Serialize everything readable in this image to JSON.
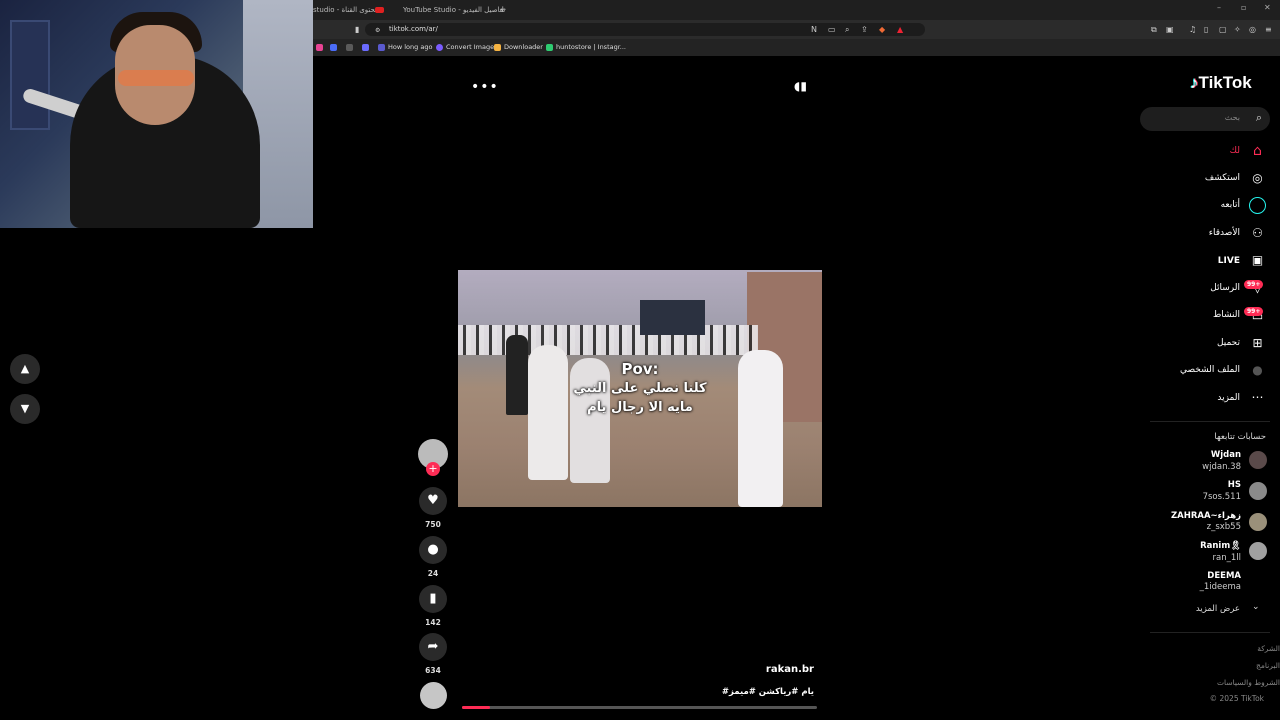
{
  "browser": {
    "tabs": [
      {
        "label": "studio - محتوى القناة"
      },
      {
        "label": ""
      },
      {
        "label": "YouTube Studio - تفاصيل الفيديو"
      }
    ],
    "new_tab": "+",
    "url": "tiktok.com/ar/",
    "bookmarks": [
      {
        "label": "",
        "color": "#e84393"
      },
      {
        "label": "",
        "color": "#4a6cf7"
      },
      {
        "label": "",
        "color": "#5a5a5a"
      },
      {
        "label": "",
        "color": "#6b6bff"
      },
      {
        "label": "How long ago",
        "color": "#5a5acf"
      },
      {
        "label": "Convert Image",
        "color": "#7b5cff"
      },
      {
        "label": "Downloader",
        "color": "#f5b342"
      },
      {
        "label": "huntostore | Instagr...",
        "color": "#2ecc71"
      }
    ]
  },
  "tiktok": {
    "logo": "TikTok",
    "search_placeholder": "بحث",
    "nav": [
      {
        "label": "لك",
        "icon": "home-icon",
        "active": true
      },
      {
        "label": "استكشف",
        "icon": "compass-icon"
      },
      {
        "label": "أتابعه",
        "icon": "following-icon"
      },
      {
        "label": "الأصدقاء",
        "icon": "friends-icon"
      },
      {
        "label": "LIVE",
        "icon": "live-icon"
      },
      {
        "label": "الرسائل",
        "icon": "messages-icon",
        "badge": "99+"
      },
      {
        "label": "النشاط",
        "icon": "activity-icon",
        "badge": "99+"
      },
      {
        "label": "تحميل",
        "icon": "upload-icon"
      },
      {
        "label": "الملف الشخصي",
        "icon": "profile-icon"
      },
      {
        "label": "المزيد",
        "icon": "more-icon"
      }
    ],
    "following_title": "حسابات تتابعها",
    "accounts": [
      {
        "name": "Wjdan",
        "user": "wjdan.38"
      },
      {
        "name": "HS",
        "user": "7sos.511"
      },
      {
        "name": "ZAHRAA~زهراء",
        "user": "z_sxb55"
      },
      {
        "name": "Ranim🎗",
        "user": "ran_1ll"
      },
      {
        "name": "DEEMA",
        "user": "_1ideema"
      }
    ],
    "see_more": "عرض المزيد",
    "footer": [
      "الشركة",
      "البرنامج",
      "الشروط والسياسات",
      "© 2025 TikTok"
    ],
    "video": {
      "caption_pov": "Pov:",
      "caption_line1": "كلنا نصلي على النبي",
      "caption_line2": "مايه الا رجال يام",
      "author": "rakan.br",
      "tags": "#يام #رياكشن #ميمز",
      "likes": "750",
      "comments": "24",
      "saves": "142",
      "shares": "634",
      "progress": 0.08
    },
    "colors": {
      "accent": "#fe2c55",
      "cyan": "#25f4ee"
    }
  }
}
